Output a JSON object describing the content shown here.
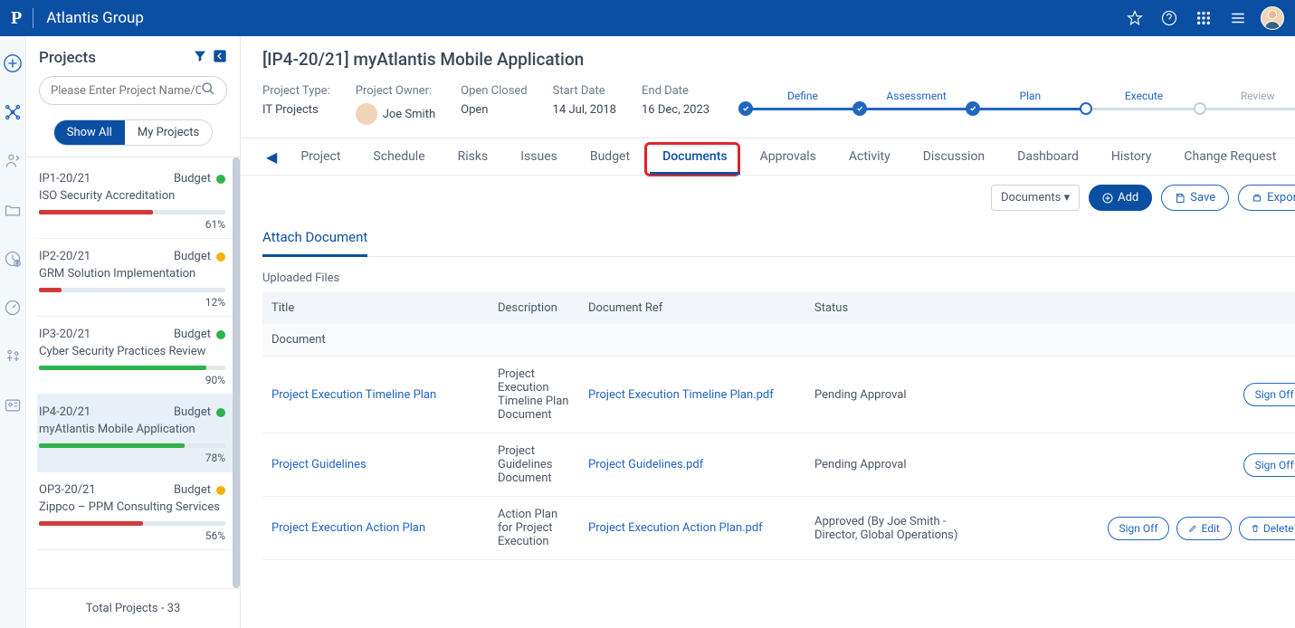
{
  "header": {
    "app": "P",
    "title": "Atlantis Group"
  },
  "sidebar": {
    "title": "Projects",
    "search_placeholder": "Please Enter Project Name/Code",
    "toggle": {
      "all": "Show All",
      "mine": "My Projects"
    },
    "total": "Total Projects - 33",
    "items": [
      {
        "code": "IP1-20/21",
        "budget_label": "Budget",
        "dot": "#2fb34a",
        "name": "ISO Security Accreditation",
        "pct": "61%",
        "fill": 61,
        "color": "#d23a3a"
      },
      {
        "code": "IP2-20/21",
        "budget_label": "Budget",
        "dot": "#f2b300",
        "name": "GRM Solution Implementation",
        "pct": "12%",
        "fill": 12,
        "color": "#d23a3a"
      },
      {
        "code": "IP3-20/21",
        "budget_label": "Budget",
        "dot": "#2fb34a",
        "name": "Cyber Security Practices Review",
        "pct": "90%",
        "fill": 90,
        "color": "#2fb34a"
      },
      {
        "code": "IP4-20/21",
        "budget_label": "Budget",
        "dot": "#2fb34a",
        "name": "myAtlantis Mobile Application",
        "pct": "78%",
        "fill": 78,
        "color": "#2fb34a"
      },
      {
        "code": "OP3-20/21",
        "budget_label": "Budget",
        "dot": "#f2b300",
        "name": "Zippco – PPM Consulting Services",
        "pct": "56%",
        "fill": 56,
        "color": "#d23a3a"
      }
    ]
  },
  "project": {
    "title": "[IP4-20/21] myAtlantis Mobile Application",
    "type_label": "Project Type:",
    "type": "IT Projects",
    "owner_label": "Project Owner:",
    "owner": "Joe Smith",
    "status_label": "Open Closed",
    "status": "Open",
    "start_label": "Start Date",
    "start": "14 Jul, 2018",
    "end_label": "End Date",
    "end": "16 Dec, 2023",
    "stages": [
      "Define",
      "Assessment",
      "Plan",
      "Execute",
      "Review"
    ]
  },
  "tabs": [
    "Project",
    "Schedule",
    "Risks",
    "Issues",
    "Budget",
    "Documents",
    "Approvals",
    "Activity",
    "Discussion",
    "Dashboard",
    "History",
    "Change Request"
  ],
  "toolbar": {
    "dropdown": "Documents ▾",
    "add": "Add",
    "save": "Save",
    "export": "Export"
  },
  "docs": {
    "section": "Attach Document",
    "uploaded": "Uploaded Files",
    "cols": {
      "title": "Title",
      "desc": "Description",
      "ref": "Document Ref",
      "status": "Status"
    },
    "group": "Document",
    "rows": [
      {
        "title": "Project Execution Timeline Plan",
        "desc": "Project Execution Timeline Plan Document",
        "ref": "Project Execution Timeline Plan.pdf",
        "status": "Pending Approval",
        "actions": [
          "Sign Off"
        ]
      },
      {
        "title": "Project Guidelines",
        "desc": "Project Guidelines Document",
        "ref": "Project Guidelines.pdf",
        "status": "Pending Approval",
        "actions": [
          "Sign Off"
        ]
      },
      {
        "title": "Project Execution Action Plan",
        "desc": "Action Plan for Project Execution",
        "ref": "Project Execution Action Plan.pdf",
        "status": "Approved (By Joe Smith - Director, Global Operations)",
        "actions": [
          "Sign Off",
          "Edit",
          "Delete"
        ]
      }
    ]
  }
}
